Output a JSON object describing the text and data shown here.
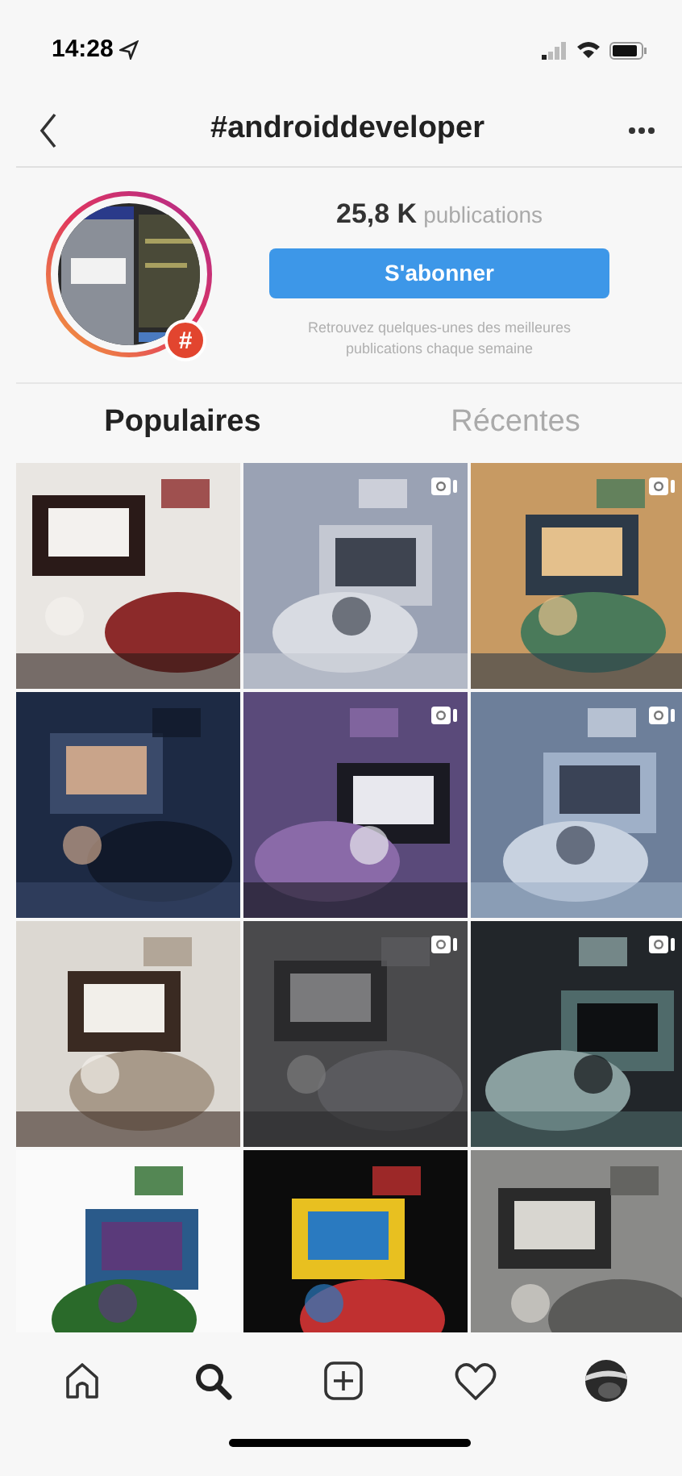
{
  "status_bar": {
    "time": "14:28"
  },
  "header": {
    "title": "#androiddeveloper"
  },
  "profile": {
    "count": "25,8 K",
    "count_label": "publications",
    "follow_button": "S'abonner",
    "hint": "Retrouvez quelques-unes des meilleures publications chaque semaine",
    "badge": "#"
  },
  "tabs": [
    {
      "label": "Populaires",
      "selected": true
    },
    {
      "label": "Récentes",
      "selected": false
    }
  ],
  "posts": [
    {
      "kind": "picture",
      "video": false
    },
    {
      "kind": "picture",
      "video": true
    },
    {
      "kind": "picture",
      "video": true
    },
    {
      "kind": "picture",
      "video": false
    },
    {
      "kind": "picture",
      "video": true
    },
    {
      "kind": "picture",
      "video": true
    },
    {
      "kind": "picture",
      "video": false
    },
    {
      "kind": "picture",
      "video": true
    },
    {
      "kind": "picture",
      "video": true
    },
    {
      "kind": "picture",
      "video": false
    },
    {
      "kind": "picture",
      "video": false
    },
    {
      "kind": "picture",
      "video": false
    }
  ]
}
